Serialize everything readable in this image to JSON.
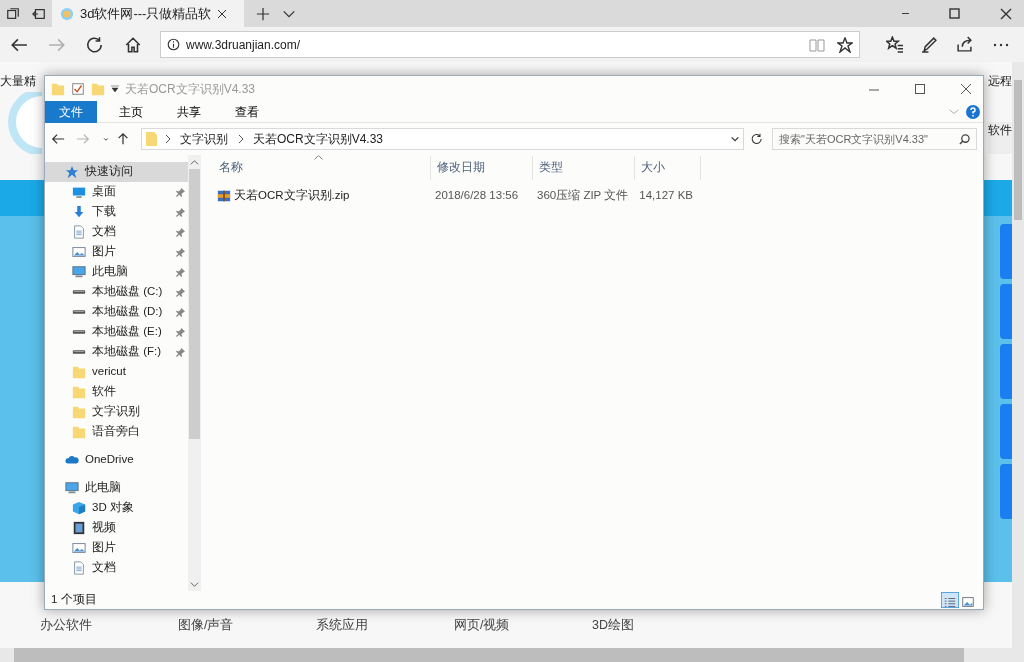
{
  "browser": {
    "tabs": [
      {
        "title": "3d软件网---只做精品软",
        "selected": true
      }
    ],
    "nav_buttons": [
      {
        "kind": "back",
        "disabled": false
      },
      {
        "kind": "forward",
        "disabled": true
      },
      {
        "kind": "refresh",
        "disabled": false
      },
      {
        "kind": "home",
        "disabled": false
      }
    ],
    "address": "www.3druanjian.com/"
  },
  "page": {
    "top_left": "大量精",
    "top_right": "远程",
    "side_text": "软件",
    "categories": [
      "办公软件",
      "图像/声音",
      "系统应用",
      "网页/视频",
      "3D绘图"
    ]
  },
  "explorer": {
    "title": "天若OCR文字识别V4.33",
    "ribbon_tabs": [
      {
        "label": "文件",
        "selected": true
      },
      {
        "label": "主页",
        "selected": false
      },
      {
        "label": "共享",
        "selected": false
      },
      {
        "label": "查看",
        "selected": false
      }
    ],
    "nav_buttons": [
      {
        "kind": "back",
        "disabled": false
      },
      {
        "kind": "forward",
        "disabled": true
      },
      {
        "kind": "recent",
        "disabled": false
      },
      {
        "kind": "up",
        "disabled": false
      }
    ],
    "breadcrumb": [
      "文字识别",
      "天若OCR文字识别V4.33"
    ],
    "search": {
      "placeholder": "搜索\"天若OCR文字识别V4.33\""
    },
    "nav_tree": [
      {
        "label": "快速访问",
        "kind": "star",
        "selected": true,
        "children": [
          {
            "label": "桌面",
            "kind": "desktop",
            "pinned": true
          },
          {
            "label": "下载",
            "kind": "download",
            "pinned": true
          },
          {
            "label": "文档",
            "kind": "document",
            "pinned": true
          },
          {
            "label": "图片",
            "kind": "picture",
            "pinned": true
          },
          {
            "label": "此电脑",
            "kind": "computer",
            "pinned": true
          },
          {
            "label": "本地磁盘 (C:)",
            "kind": "drive",
            "pinned": true
          },
          {
            "label": "本地磁盘 (D:)",
            "kind": "drive",
            "pinned": true
          },
          {
            "label": "本地磁盘 (E:)",
            "kind": "drive",
            "pinned": true
          },
          {
            "label": "本地磁盘 (F:)",
            "kind": "drive",
            "pinned": true
          },
          {
            "label": "vericut",
            "kind": "folder",
            "pinned": false
          },
          {
            "label": "软件",
            "kind": "folder",
            "pinned": false
          },
          {
            "label": "文字识别",
            "kind": "folder",
            "pinned": false
          },
          {
            "label": "语音旁白",
            "kind": "folder",
            "pinned": false
          }
        ]
      },
      {
        "label": "OneDrive",
        "kind": "cloud",
        "selected": false
      },
      {
        "label": "此电脑",
        "kind": "computer",
        "selected": false,
        "children": [
          {
            "label": "3D 对象",
            "kind": "cube",
            "pinned": false
          },
          {
            "label": "视频",
            "kind": "video",
            "pinned": false
          },
          {
            "label": "图片",
            "kind": "picture",
            "pinned": false
          },
          {
            "label": "文档",
            "kind": "document",
            "pinned": false
          }
        ]
      }
    ],
    "columns": [
      {
        "label": "名称",
        "sorted": true
      },
      {
        "label": "修改日期",
        "sorted": false
      },
      {
        "label": "类型",
        "sorted": false
      },
      {
        "label": "大小",
        "sorted": false
      }
    ],
    "files": [
      {
        "name": "天若OCR文字识别.zip",
        "modified": "2018/6/28 13:56",
        "type": "360压缩 ZIP 文件",
        "size": "14,127 KB",
        "selected": false
      }
    ],
    "status": "1 个项目",
    "views": [
      {
        "kind": "details",
        "selected": true
      },
      {
        "kind": "thumbnails",
        "selected": false
      }
    ]
  }
}
